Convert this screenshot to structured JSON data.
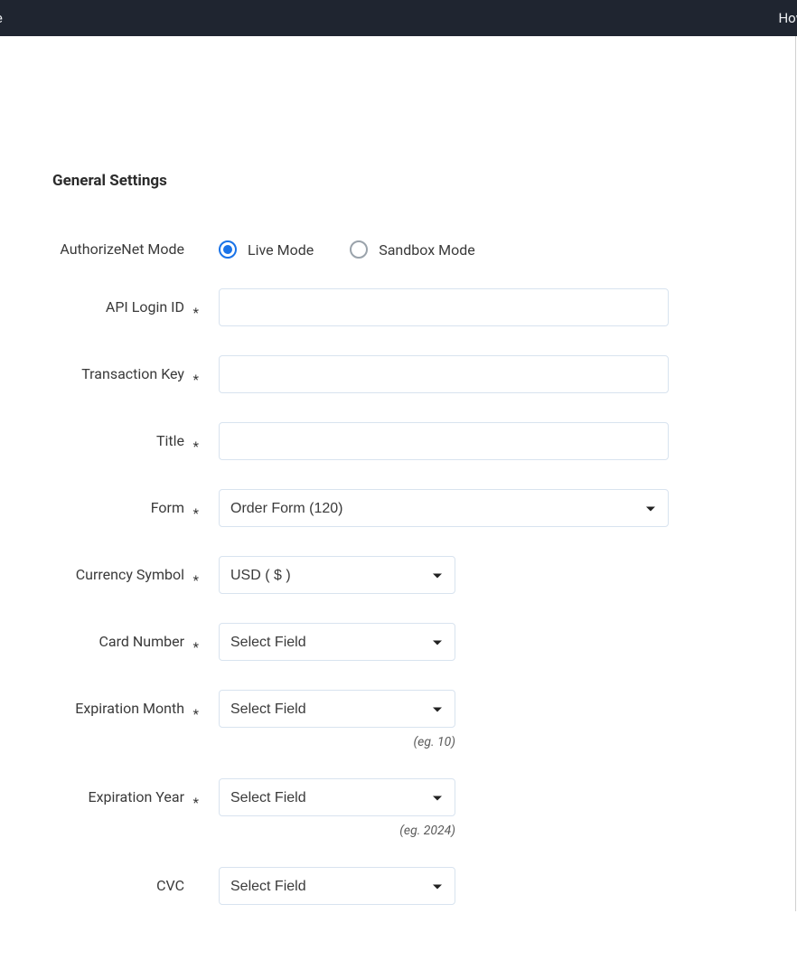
{
  "topbar": {
    "left_fragment": "te",
    "right_fragment": "How"
  },
  "section": {
    "title": "General Settings"
  },
  "fields": {
    "mode": {
      "label": "AuthorizeNet Mode",
      "options": {
        "live": "Live Mode",
        "sandbox": "Sandbox Mode"
      },
      "selected": "live"
    },
    "api_login_id": {
      "label": "API Login ID",
      "value": ""
    },
    "transaction_key": {
      "label": "Transaction Key",
      "value": ""
    },
    "title": {
      "label": "Title",
      "value": ""
    },
    "form": {
      "label": "Form",
      "selected": "Order Form (120)"
    },
    "currency": {
      "label": "Currency Symbol",
      "selected": "USD ( $ )"
    },
    "card_number": {
      "label": "Card Number",
      "selected": "Select Field"
    },
    "exp_month": {
      "label": "Expiration Month",
      "selected": "Select Field",
      "hint": "(eg. 10)"
    },
    "exp_year": {
      "label": "Expiration Year",
      "selected": "Select Field",
      "hint": "(eg. 2024)"
    },
    "cvc": {
      "label": "CVC",
      "selected": "Select Field"
    }
  }
}
